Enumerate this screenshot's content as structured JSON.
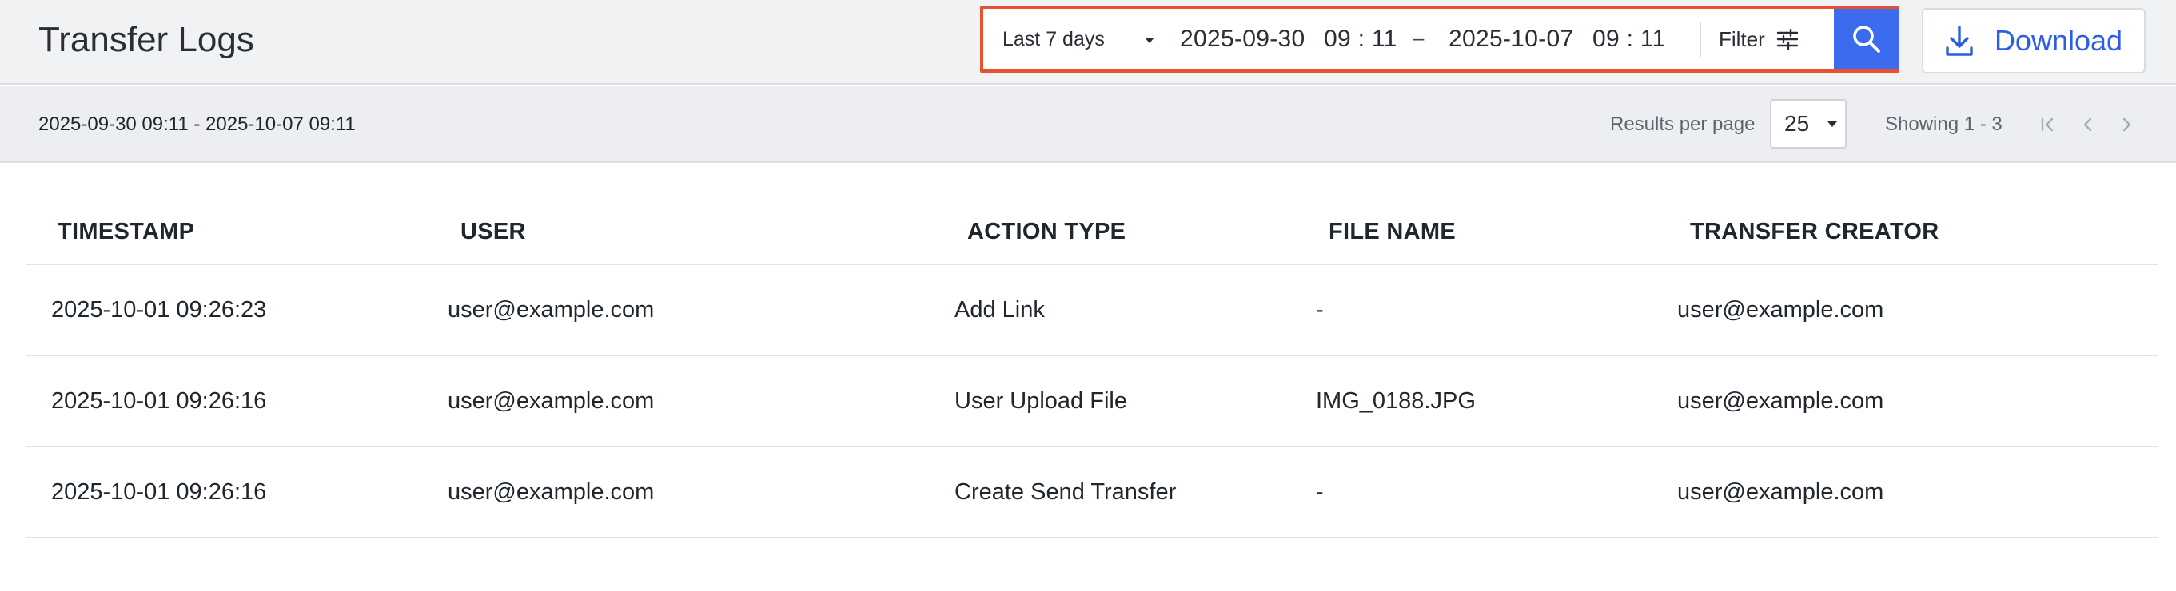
{
  "header": {
    "title": "Transfer Logs",
    "range_preset": "Last 7 days",
    "start_date": "2025-09-30",
    "start_time": "09 : 11",
    "range_separator": "–",
    "end_date": "2025-10-07",
    "end_time": "09 : 11",
    "filter_label": "Filter",
    "download_label": "Download",
    "highlight_color": "#e8502f",
    "accent_color": "#3b6cf0"
  },
  "subheader": {
    "range_text": "2025-09-30 09:11 - 2025-10-07 09:11",
    "results_per_page_label": "Results per page",
    "results_per_page_value": "25",
    "showing_text": "Showing 1 - 3"
  },
  "icons": {
    "filter": "sliders-icon",
    "search": "search-icon",
    "download": "download-icon",
    "pager_first": "first-page-icon",
    "pager_prev": "chevron-left-icon",
    "pager_next": "chevron-right-icon"
  },
  "table": {
    "columns": [
      "TIMESTAMP",
      "USER",
      "ACTION TYPE",
      "FILE NAME",
      "TRANSFER CREATOR"
    ],
    "rows": [
      [
        "2025-10-01 09:26:23",
        "user@example.com",
        "Add Link",
        "-",
        "user@example.com"
      ],
      [
        "2025-10-01 09:26:16",
        "user@example.com",
        "User Upload File",
        "IMG_0188.JPG",
        "user@example.com"
      ],
      [
        "2025-10-01 09:26:16",
        "user@example.com",
        "Create Send Transfer",
        "-",
        "user@example.com"
      ]
    ]
  }
}
